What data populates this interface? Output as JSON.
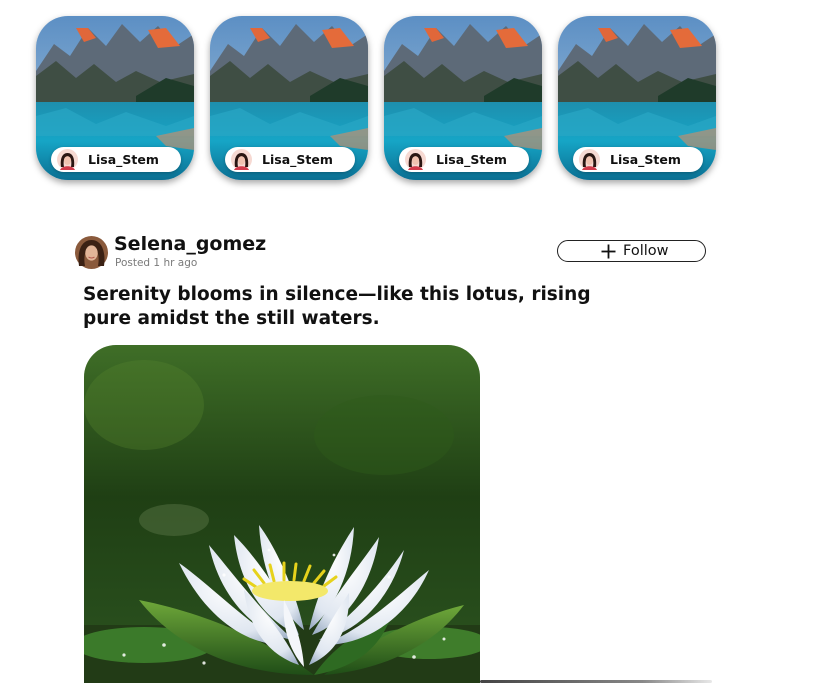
{
  "stories": [
    {
      "username": "Lisa_Stem"
    },
    {
      "username": "Lisa_Stem"
    },
    {
      "username": "Lisa_Stem"
    },
    {
      "username": "Lisa_Stem"
    }
  ],
  "post": {
    "username": "Selena_gomez",
    "posted_time": "Posted 1 hr ago",
    "follow_label": "Follow",
    "caption": "Serenity blooms in silence—like this lotus, rising pure amidst the still waters."
  },
  "icons": {
    "follow": "plus-icon",
    "story_avatar": "avatar",
    "post_avatar": "avatar"
  },
  "colors": {
    "text": "#111111",
    "muted": "#7a7a7a",
    "border": "#222222",
    "background": "#ffffff"
  }
}
